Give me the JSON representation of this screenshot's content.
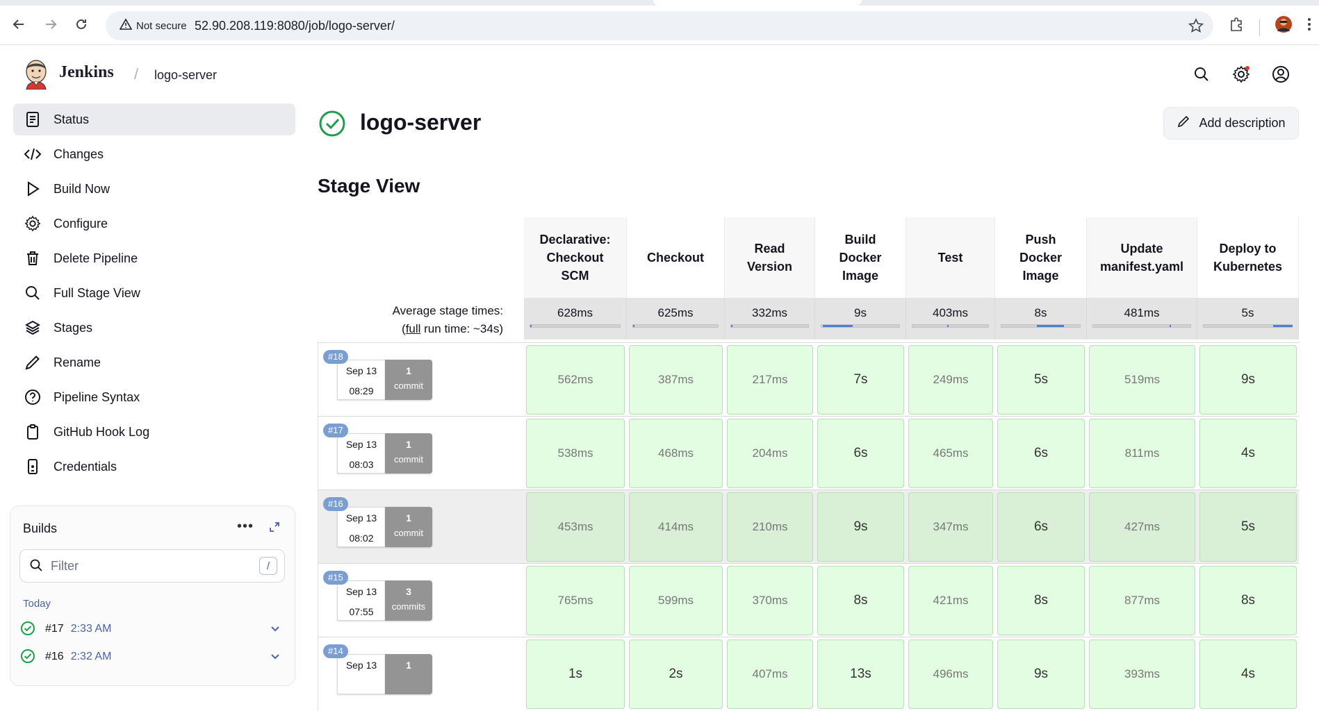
{
  "browser": {
    "security_label": "Not secure",
    "url": "52.90.208.119:8080/job/logo-server/"
  },
  "header": {
    "brand": "Jenkins",
    "breadcrumb_job": "logo-server"
  },
  "sidebar": {
    "items": [
      {
        "label": "Status",
        "icon": "status-icon"
      },
      {
        "label": "Changes",
        "icon": "code-icon"
      },
      {
        "label": "Build Now",
        "icon": "play-icon"
      },
      {
        "label": "Configure",
        "icon": "gear-icon"
      },
      {
        "label": "Delete Pipeline",
        "icon": "trash-icon"
      },
      {
        "label": "Full Stage View",
        "icon": "search-icon"
      },
      {
        "label": "Stages",
        "icon": "layers-icon"
      },
      {
        "label": "Rename",
        "icon": "pencil-icon"
      },
      {
        "label": "Pipeline Syntax",
        "icon": "help-icon"
      },
      {
        "label": "GitHub Hook Log",
        "icon": "clipboard-icon"
      },
      {
        "label": "Credentials",
        "icon": "phone-icon"
      }
    ]
  },
  "builds": {
    "title": "Builds",
    "filter_placeholder": "Filter",
    "filter_shortcut": "/",
    "group_label": "Today",
    "items": [
      {
        "number": "#17",
        "time": "2:33 AM"
      },
      {
        "number": "#16",
        "time": "2:32 AM"
      }
    ]
  },
  "main": {
    "job_title": "logo-server",
    "add_description_label": "Add description",
    "stage_view_title": "Stage View",
    "avg_label_line1": "Average stage times:",
    "avg_label_pre": "(",
    "avg_label_link": "full",
    "avg_label_post": " run time: ~34s)"
  },
  "stage_view": {
    "stages": [
      {
        "lines": [
          "Declarative:",
          "Checkout",
          "SCM"
        ],
        "avg": "628ms",
        "avg_fraction": 0.0
      },
      {
        "lines": [
          "Checkout"
        ],
        "avg": "625ms",
        "avg_fraction": 0.0
      },
      {
        "lines": [
          "Read",
          "Version"
        ],
        "avg": "332ms",
        "avg_fraction": 0.0
      },
      {
        "lines": [
          "Build",
          "Docker",
          "Image"
        ],
        "avg": "9s",
        "avg_fraction": 0.38
      },
      {
        "lines": [
          "Test"
        ],
        "avg": "403ms",
        "avg_fraction": 0.0
      },
      {
        "lines": [
          "Push",
          "Docker",
          "Image"
        ],
        "avg": "8s",
        "avg_fraction": 0.34
      },
      {
        "lines": [
          "Update",
          "manifest.yaml"
        ],
        "avg": "481ms",
        "avg_fraction": 0.0
      },
      {
        "lines": [
          "Deploy to",
          "Kubernetes"
        ],
        "avg": "5s",
        "avg_fraction": 0.22
      }
    ],
    "runs": [
      {
        "badge": "#18",
        "date": "Sep 13",
        "time": "08:29",
        "commit_count": "1",
        "commit_word": "commit",
        "durations": [
          "562ms",
          "387ms",
          "217ms",
          "7s",
          "249ms",
          "5s",
          "519ms",
          "9s"
        ]
      },
      {
        "badge": "#17",
        "date": "Sep 13",
        "time": "08:03",
        "commit_count": "1",
        "commit_word": "commit",
        "durations": [
          "538ms",
          "468ms",
          "204ms",
          "6s",
          "465ms",
          "6s",
          "811ms",
          "4s"
        ]
      },
      {
        "badge": "#16",
        "date": "Sep 13",
        "time": "08:02",
        "commit_count": "1",
        "commit_word": "commit",
        "durations": [
          "453ms",
          "414ms",
          "210ms",
          "9s",
          "347ms",
          "6s",
          "427ms",
          "5s"
        ]
      },
      {
        "badge": "#15",
        "date": "Sep 13",
        "time": "07:55",
        "commit_count": "3",
        "commit_word": "commits",
        "durations": [
          "765ms",
          "599ms",
          "370ms",
          "8s",
          "421ms",
          "8s",
          "877ms",
          "8s"
        ]
      },
      {
        "badge": "#14",
        "date": "Sep 13",
        "time": "",
        "commit_count": "1",
        "commit_word": "",
        "durations": [
          "1s",
          "2s",
          "407ms",
          "13s",
          "496ms",
          "9s",
          "393ms",
          "4s"
        ]
      }
    ]
  },
  "colors": {
    "success_green": "#1e9e4a",
    "stage_cell_bg": "#e3fde2",
    "badge_blue": "#7a9ed2",
    "link_blue": "#4c62a7"
  }
}
